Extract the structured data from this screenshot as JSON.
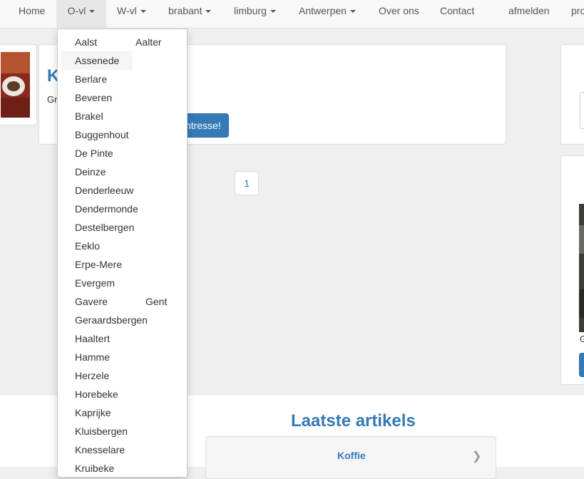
{
  "nav": {
    "items": [
      {
        "label": "Home"
      },
      {
        "label": "O-vl"
      },
      {
        "label": "W-vl"
      },
      {
        "label": "brabant"
      },
      {
        "label": "limburg"
      },
      {
        "label": "Antwerpen"
      },
      {
        "label": "Over ons"
      },
      {
        "label": "Contact"
      },
      {
        "label": "afmelden"
      },
      {
        "label": "pro"
      }
    ]
  },
  "dropdown": {
    "items": [
      "Aalst",
      "Aalter",
      "Assenede",
      "Berlare",
      "Beveren",
      "Brakel",
      "Buggenhout",
      "De Pinte",
      "Deinze",
      "Denderleeuw",
      "Dendermonde",
      "Destelbergen",
      "Eeklo",
      "Erpe-Mere",
      "Evergem",
      "Gavere",
      "Gent",
      "Geraardsbergen",
      "Haaltert",
      "Hamme",
      "Herzele",
      "Horebeke",
      "Kaprijke",
      "Kluisbergen",
      "Knesselare",
      "Kruibeke"
    ]
  },
  "listing": {
    "title_partial": "K",
    "desc_partial": "Gr",
    "button_partial": "ntresse!"
  },
  "pager": {
    "page": "1"
  },
  "right_col": {
    "caption_partial": "G"
  },
  "latest": {
    "title": "Laatste artikels",
    "articles": [
      {
        "title": "Koffie"
      }
    ]
  },
  "colors": {
    "link": "#337ab7",
    "navbar": "#f8f8f8",
    "background": "#efefef"
  }
}
